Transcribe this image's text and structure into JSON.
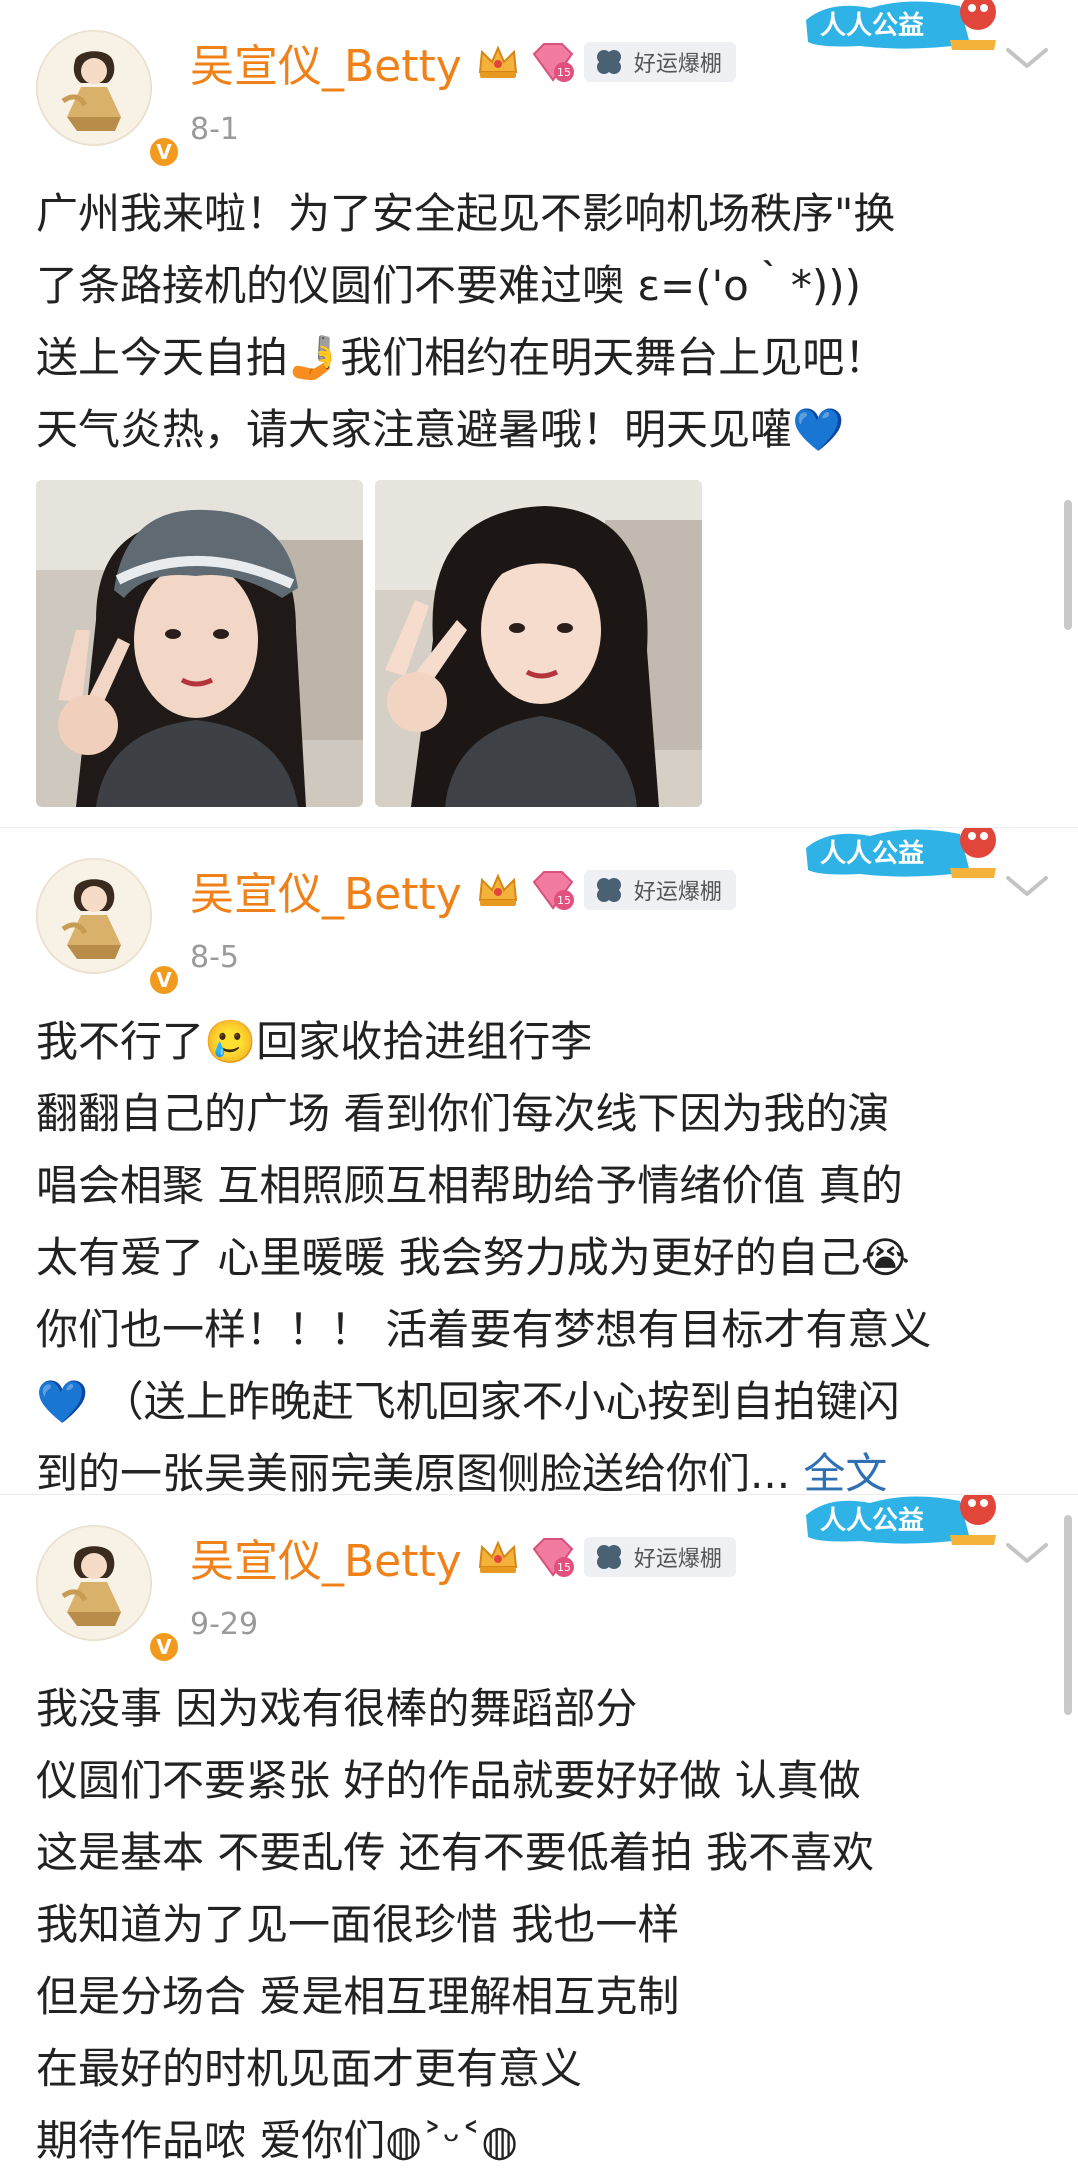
{
  "posts": [
    {
      "username": "吴宣仪_Betty",
      "date": "8-1",
      "tag": "好运爆棚",
      "charity_badge": "人人公益",
      "lines": [
        "广州我来啦！为了安全起见不影响机场秩序\"换",
        "了条路接机的仪圆们不要难过噢 ε=('ο｀*)))",
        "送上今天自拍🤳我们相约在明天舞台上见吧！",
        "天气炎热，请大家注意避暑哦！明天见嚾💙"
      ],
      "photos": [
        "selfie-with-cap",
        "selfie-without-cap"
      ]
    },
    {
      "username": "吴宣仪_Betty",
      "date": "8-5",
      "tag": "好运爆棚",
      "charity_badge": "人人公益",
      "lines": [
        "我不行了🥲回家收拾进组行李",
        "翻翻自己的广场 看到你们每次线下因为我的演",
        "唱会相聚 互相照顾互相帮助给予情绪价值 真的",
        "太有爱了 心里暖暖 我会努力成为更好的自己😭",
        "你们也一样！！！ 活着要有梦想有目标才有意义",
        "💙 （送上昨晚赶飞机回家不小心按到自拍键闪",
        "到的一张吴美丽完美原图侧脸送给你们..."
      ],
      "fulltext_label": "全文"
    },
    {
      "username": "吴宣仪_Betty",
      "date": "9-29",
      "tag": "好运爆棚",
      "charity_badge": "人人公益",
      "lines": [
        "我没事 因为戏有很棒的舞蹈部分",
        "仪圆们不要紧张 好的作品就要好好做 认真做",
        "这是基本 不要乱传 还有不要低着拍 我不喜欢",
        "我知道为了见一面很珍惜 我也一样",
        "但是分场合 爱是相互理解相互克制",
        "在最好的时机见面才更有意义",
        "期待作品哝 爱你们◍˃ᵕ˂◍"
      ]
    }
  ],
  "colors": {
    "username": "#f08118",
    "verified_badge": "#f29a1e",
    "link": "#2f6fb3",
    "date": "#9a9a9a"
  },
  "icons": [
    "crown-icon",
    "level-icon",
    "clover-icon",
    "chevron-down-icon",
    "verified-icon"
  ]
}
